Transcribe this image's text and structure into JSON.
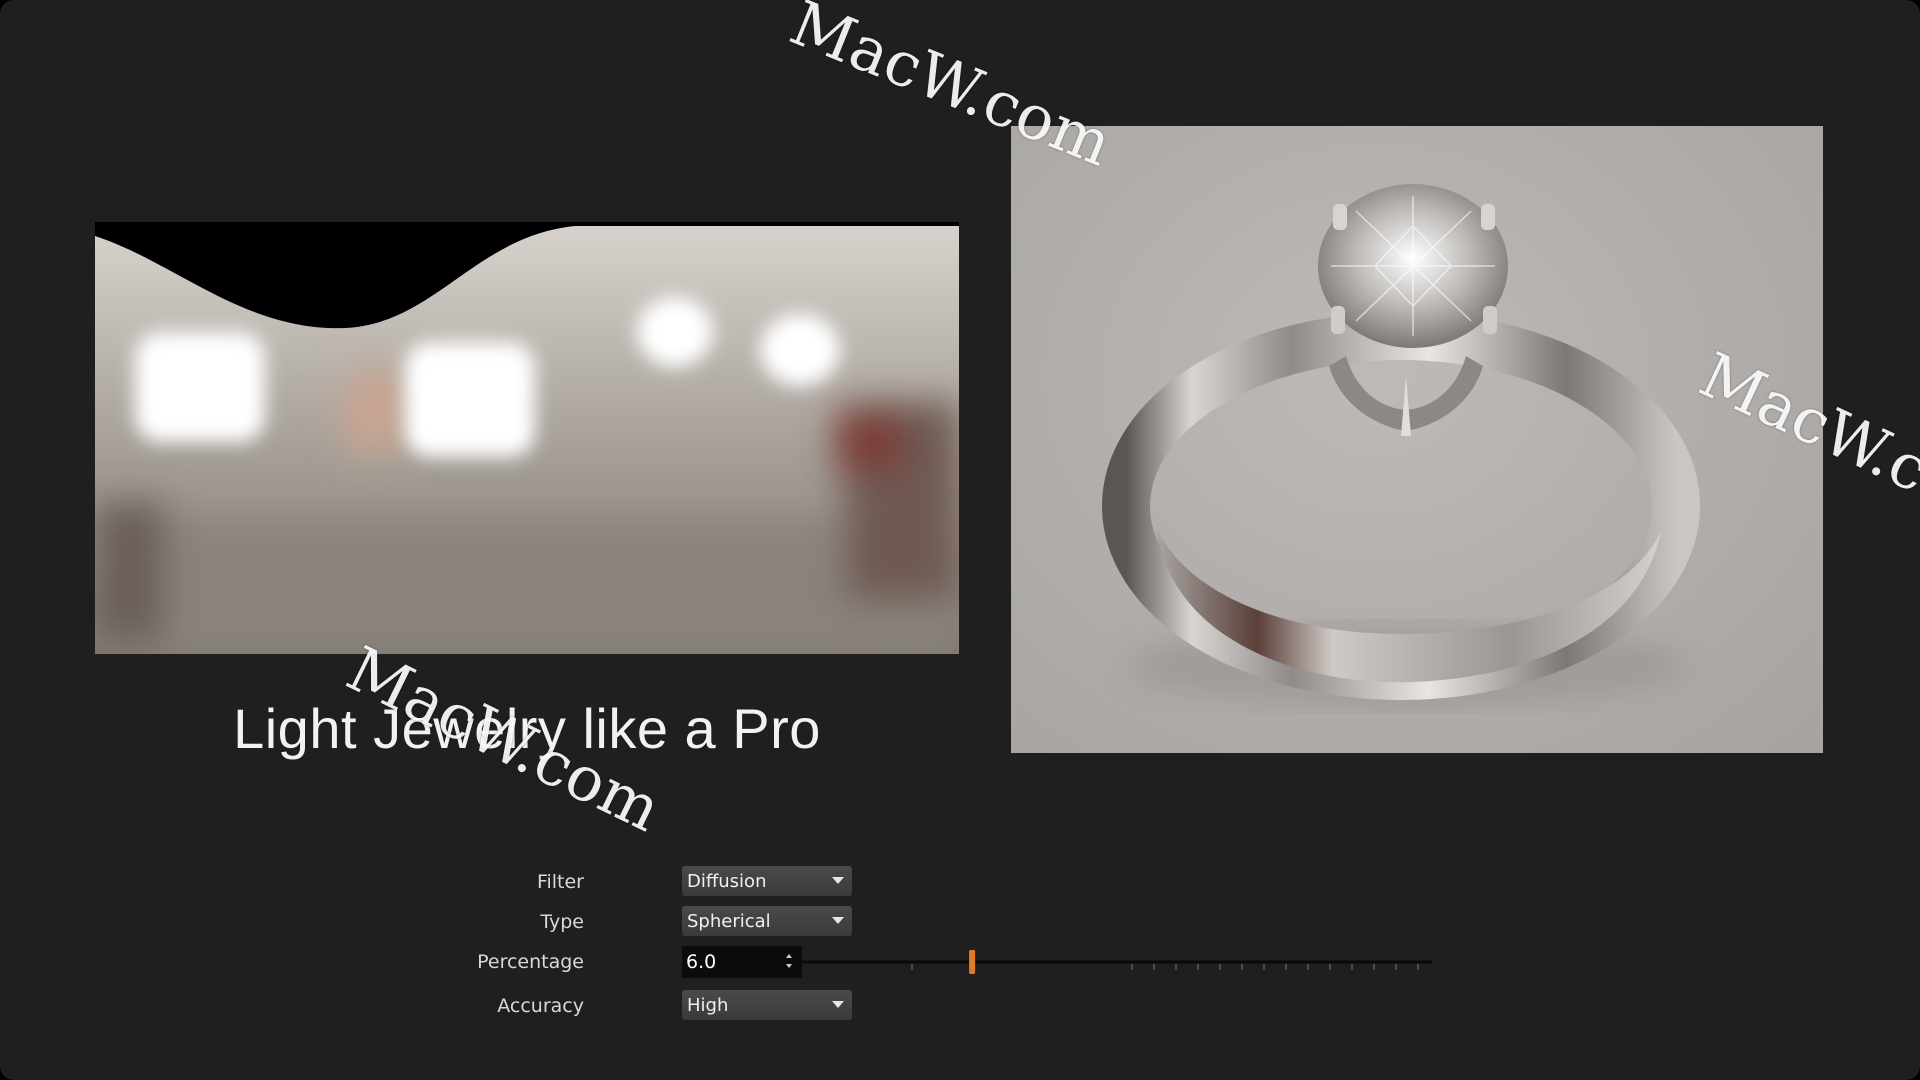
{
  "caption": "Light Jewelry like a Pro",
  "controls": {
    "filter": {
      "label": "Filter",
      "value": "Diffusion"
    },
    "type": {
      "label": "Type",
      "value": "Spherical"
    },
    "percentage": {
      "label": "Percentage",
      "value": "6.0",
      "slider_fraction": 0.27
    },
    "accuracy": {
      "label": "Accuracy",
      "value": "High"
    }
  },
  "watermarks": [
    "MacW.com",
    "MacW.com",
    "MacW.com"
  ],
  "colors": {
    "background": "#1f1f1f",
    "slider_handle": "#e07b2a"
  }
}
